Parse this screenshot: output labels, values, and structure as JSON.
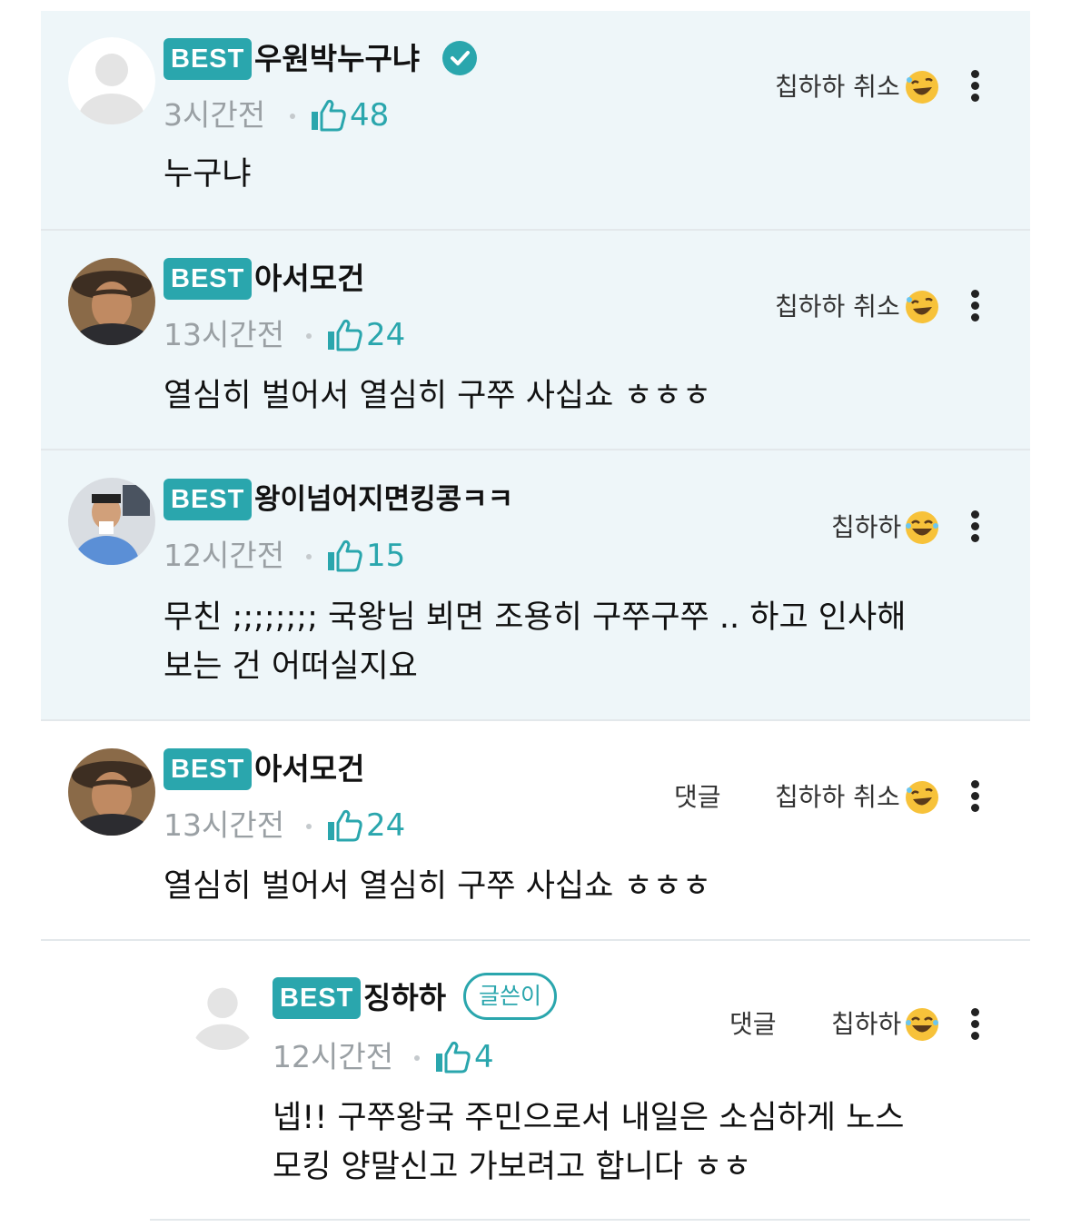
{
  "comments": [
    {
      "best_label": "BEST",
      "nickname": "우원박누구냐",
      "verified": true,
      "time": "3시간전",
      "likes": "48",
      "text": "누구냐",
      "reaction_label": "칩하하 취소",
      "avatar": "default-avatar",
      "highlighted": true
    },
    {
      "best_label": "BEST",
      "nickname": "아서모건",
      "time": "13시간전",
      "likes": "24",
      "text": "열심히 벌어서 열심히 구쭈 사십쇼 ㅎㅎㅎ",
      "reaction_label": "칩하하 취소",
      "avatar": "cowboy-avatar",
      "highlighted": true
    },
    {
      "best_label": "BEST",
      "nickname": "왕이넘어지면킹콩ㅋㅋ",
      "time": "12시간전",
      "likes": "15",
      "text_line1": "무친 ;;;;;;;; 국왕님 뵈면 조용히 구쭈구쭈 .. 하고 인사해",
      "text_line2": "보는 건 어떠실지요",
      "reaction_label": "칩하하",
      "avatar": "man-photo-avatar",
      "highlighted": true
    },
    {
      "best_label": "BEST",
      "nickname": "아서모건",
      "time": "13시간전",
      "likes": "24",
      "text": "열심히 벌어서 열심히 구쭈 사십쇼 ㅎㅎㅎ",
      "reply_label": "댓글",
      "reaction_label": "칩하하 취소",
      "avatar": "cowboy-avatar",
      "highlighted": false
    },
    {
      "best_label": "BEST",
      "nickname": "징하하",
      "author_badge": "글쓴이",
      "time": "12시간전",
      "likes": "4",
      "text_line1": "넵!! 구쭈왕국 주민으로서 내일은 소심하게 노스",
      "text_line2": "모킹 양말신고 가보려고 합니다 ㅎㅎ",
      "reply_label": "댓글",
      "reaction_label": "칩하하",
      "avatar": "default-avatar",
      "highlighted": false
    }
  ],
  "colors": {
    "accent": "#2aa6ad",
    "highlight_bg": "#eef6f9",
    "muted_text": "#9aa0a4"
  },
  "icons": [
    "thumbs-up-icon",
    "laughing-emoji-icon",
    "more-vertical-icon",
    "verified-check-icon"
  ]
}
